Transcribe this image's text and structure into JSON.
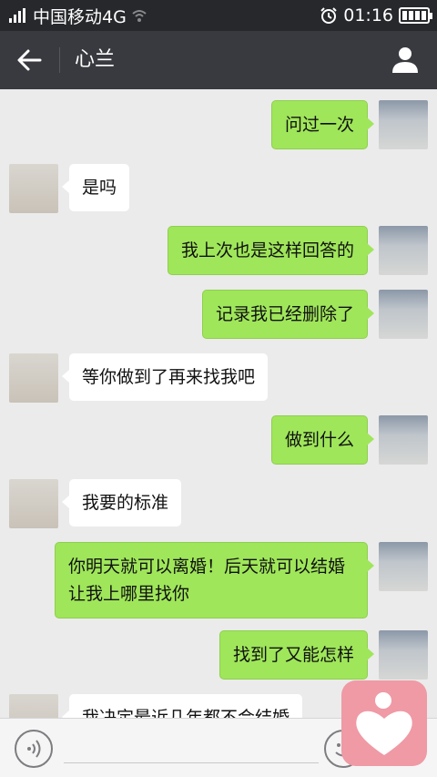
{
  "status_bar": {
    "carrier": "中国移动4G",
    "time": "01:16"
  },
  "header": {
    "title": "心兰"
  },
  "messages": [
    {
      "side": "out",
      "text": "问过一次"
    },
    {
      "side": "in",
      "text": "是吗"
    },
    {
      "side": "out",
      "text": "我上次也是这样回答的"
    },
    {
      "side": "out",
      "text": "记录我已经删除了"
    },
    {
      "side": "in",
      "text": "等你做到了再来找我吧"
    },
    {
      "side": "out",
      "text": "做到什么"
    },
    {
      "side": "in",
      "text": "我要的标准"
    },
    {
      "side": "out",
      "text": "你明天就可以离婚！后天就可以结婚让我上哪里找你"
    },
    {
      "side": "out",
      "text": "找到了又能怎样"
    },
    {
      "side": "in",
      "text": "我决定最近几年都不会结婚"
    }
  ],
  "colors": {
    "status_bg": "#27282c",
    "header_bg": "#393a3f",
    "chat_bg": "#ebebeb",
    "bubble_out": "#9fe65a",
    "bubble_in": "#ffffff",
    "watermark": "#ef9aa5"
  },
  "icons": [
    "signal-icon",
    "wifi-icon",
    "alarm-icon",
    "battery-icon",
    "back-arrow-icon",
    "contact-icon",
    "voice-icon",
    "emoji-icon",
    "heart-logo"
  ]
}
